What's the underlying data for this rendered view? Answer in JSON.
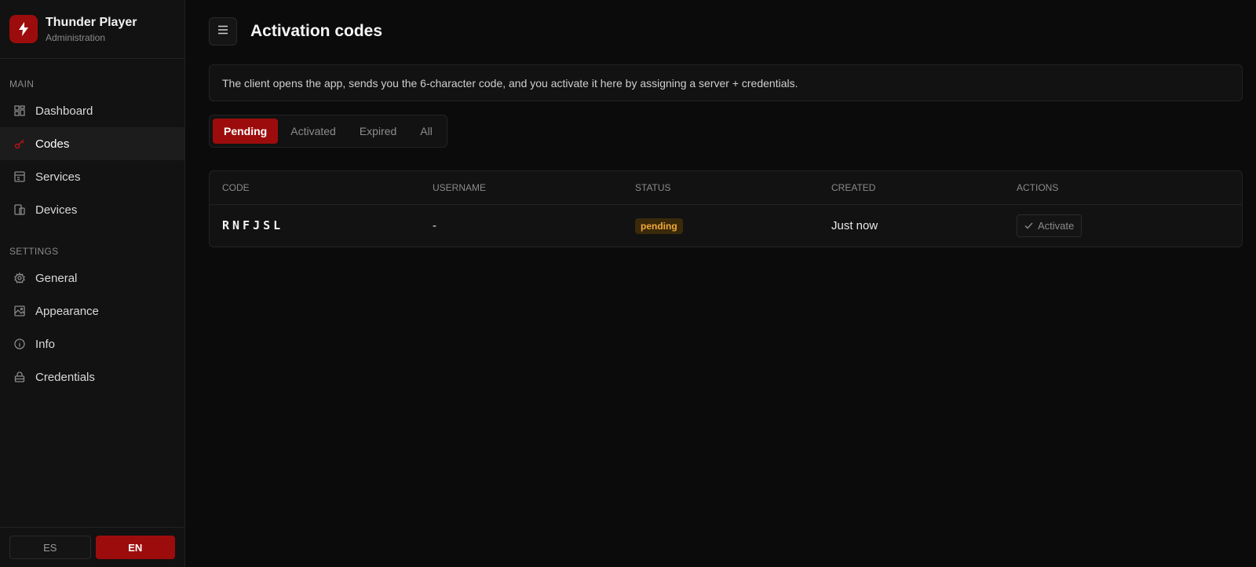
{
  "brand": {
    "title": "Thunder Player",
    "subtitle": "Administration",
    "icon": "bolt-icon",
    "color": "#9d0c0c"
  },
  "sidebar": {
    "main_label": "MAIN",
    "main_items": [
      {
        "label": "Dashboard",
        "icon": "dashboard-icon"
      },
      {
        "label": "Codes",
        "icon": "key-icon",
        "active": true
      },
      {
        "label": "Services",
        "icon": "services-icon"
      },
      {
        "label": "Devices",
        "icon": "devices-icon"
      }
    ],
    "settings_label": "SETTINGS",
    "settings_items": [
      {
        "label": "General",
        "icon": "gear-icon"
      },
      {
        "label": "Appearance",
        "icon": "image-icon"
      },
      {
        "label": "Info",
        "icon": "info-icon"
      },
      {
        "label": "Credentials",
        "icon": "lock-icon"
      }
    ],
    "languages": [
      {
        "label": "ES",
        "active": false
      },
      {
        "label": "EN",
        "active": true
      }
    ]
  },
  "header": {
    "title": "Activation codes",
    "menu_icon": "menu-icon"
  },
  "info": {
    "text": "The client opens the app, sends you the 6-character code, and you activate it here by assigning a server + credentials."
  },
  "tabs": [
    {
      "label": "Pending",
      "active": true
    },
    {
      "label": "Activated"
    },
    {
      "label": "Expired"
    },
    {
      "label": "All"
    }
  ],
  "table": {
    "columns": [
      "CODE",
      "USERNAME",
      "STATUS",
      "CREATED",
      "ACTIONS"
    ],
    "rows": [
      {
        "code": "RNFJSL",
        "username": "-",
        "status": "pending",
        "created": "Just now",
        "action": "Activate"
      }
    ]
  },
  "colors": {
    "accent": "#9d0c0c",
    "pending_badge_text": "#f2a93b",
    "pending_badge_bg": "#3a2a0a"
  }
}
